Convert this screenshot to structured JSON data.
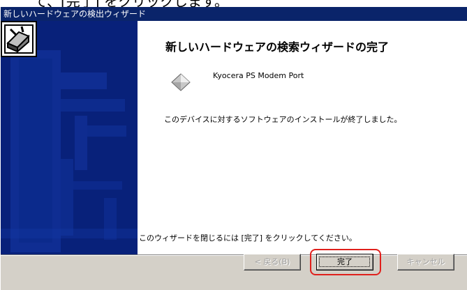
{
  "page": {
    "caption": "て、[完了] をクリックします。"
  },
  "window": {
    "title": "新しいハードウェアの検出ウィザード"
  },
  "wizard": {
    "heading": "新しいハードウェアの検索ウィザードの完了",
    "device_name": "Kyocera PS Modem Port",
    "done_message": "このデバイスに対するソフトウェアのインストールが終了しました。",
    "close_hint": "このウィザードを閉じるには [完了] をクリックしてください。"
  },
  "buttons": {
    "back_label": "< 戻る(B)",
    "finish_label": "完了",
    "cancel_label": "キャンセル"
  },
  "icons": {
    "wizard": "hardware-wizard-icon",
    "device": "modem-device-icon"
  },
  "colors": {
    "titlebar": "#0a246a",
    "sidepanel": "#08217a",
    "highlight": "#e0201c"
  }
}
